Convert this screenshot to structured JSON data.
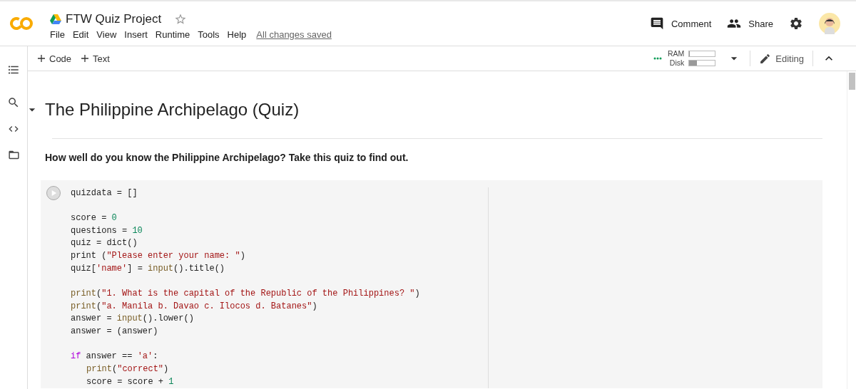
{
  "header": {
    "title": "FTW Quiz Project",
    "starred": false,
    "menu": [
      "File",
      "Edit",
      "View",
      "Insert",
      "Runtime",
      "Tools",
      "Help"
    ],
    "save_status": "All changes saved",
    "actions": [
      {
        "kind": "comment",
        "label": "Comment"
      },
      {
        "kind": "share",
        "label": "Share"
      }
    ]
  },
  "toolbar": {
    "add": [
      "Code",
      "Text"
    ],
    "resources": [
      {
        "label": "RAM",
        "level": 0.03
      },
      {
        "label": "Disk",
        "level": 0.3
      }
    ],
    "mode": "Editing"
  },
  "notebook": {
    "heading": "The Philippine Archipelago (Quiz)",
    "expanded": true,
    "intro": "How well do you know the Philippine Archipelago? Take this quiz to find out.",
    "code_blocks": [
      [
        {
          "tokens": [
            {
              "kind": "plain",
              "text": "quizdata = []"
            }
          ]
        }
      ],
      [
        {
          "tokens": [
            {
              "kind": "plain",
              "text": "score = "
            },
            {
              "kind": "number",
              "text": "0"
            }
          ]
        },
        {
          "tokens": [
            {
              "kind": "plain",
              "text": "questions = "
            },
            {
              "kind": "number",
              "text": "10"
            }
          ]
        },
        {
          "tokens": [
            {
              "kind": "plain",
              "text": "quiz = dict()"
            }
          ]
        },
        {
          "tokens": [
            {
              "kind": "plain",
              "text": "print ("
            },
            {
              "kind": "string",
              "text": "\"Please enter your name: \""
            },
            {
              "kind": "plain",
              "text": ")"
            }
          ]
        },
        {
          "tokens": [
            {
              "kind": "plain",
              "text": "quiz["
            },
            {
              "kind": "string",
              "text": "'name'"
            },
            {
              "kind": "plain",
              "text": "] = "
            },
            {
              "kind": "builtin",
              "text": "input"
            },
            {
              "kind": "plain",
              "text": "().title()"
            }
          ]
        }
      ],
      [
        {
          "tokens": [
            {
              "kind": "builtin",
              "text": "print"
            },
            {
              "kind": "plain",
              "text": "("
            },
            {
              "kind": "string",
              "text": "\"1. What is the capital of the Republic of the Philippines? \""
            },
            {
              "kind": "plain",
              "text": ")"
            }
          ]
        },
        {
          "tokens": [
            {
              "kind": "builtin",
              "text": "print"
            },
            {
              "kind": "plain",
              "text": "("
            },
            {
              "kind": "string",
              "text": "\"a. Manila b. Davao c. Ilocos d. Batanes\""
            },
            {
              "kind": "plain",
              "text": ")"
            }
          ]
        },
        {
          "tokens": [
            {
              "kind": "plain",
              "text": "answer = "
            },
            {
              "kind": "builtin",
              "text": "input"
            },
            {
              "kind": "plain",
              "text": "().lower()"
            }
          ]
        },
        {
          "tokens": [
            {
              "kind": "plain",
              "text": "answer = (answer)"
            }
          ]
        }
      ],
      [
        {
          "tokens": [
            {
              "kind": "keyword",
              "text": "if"
            },
            {
              "kind": "plain",
              "text": " answer == "
            },
            {
              "kind": "string",
              "text": "'a'"
            },
            {
              "kind": "plain",
              "text": ":"
            }
          ],
          "children": [
            {
              "tokens": [
                {
                  "kind": "builtin",
                  "text": "print"
                },
                {
                  "kind": "plain",
                  "text": "("
                },
                {
                  "kind": "string",
                  "text": "\"correct\""
                },
                {
                  "kind": "plain",
                  "text": ")"
                }
              ]
            },
            {
              "tokens": [
                {
                  "kind": "plain",
                  "text": "score = score + "
                },
                {
                  "kind": "number",
                  "text": "1"
                }
              ]
            }
          ]
        }
      ]
    ]
  }
}
